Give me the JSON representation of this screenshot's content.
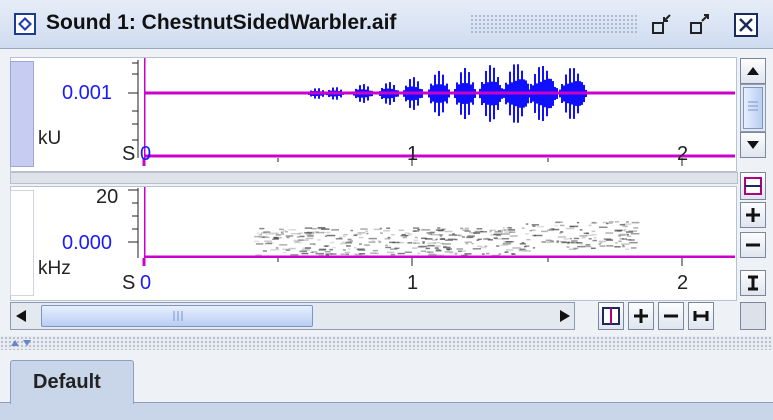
{
  "window": {
    "title": "Sound 1: ChestnutSidedWarbler.aif"
  },
  "waveform_track": {
    "value_label": "0.001",
    "unit_label": "kU",
    "time_unit": "S",
    "time_ticks": [
      "0",
      "1",
      "2"
    ]
  },
  "spectrogram_track": {
    "top_label": "20",
    "value_label": "0.000",
    "unit_label": "kHz",
    "time_unit": "S",
    "time_ticks": [
      "0",
      "1",
      "2"
    ]
  },
  "tabs": [
    {
      "label": "Default",
      "selected": true
    }
  ],
  "icons": {
    "title": "sound-window-icon",
    "minimize": "minimize-icon",
    "maximize": "maximize-icon",
    "close": "close-icon"
  },
  "colors": {
    "waveform": "#1010ff",
    "cursor_line": "#cc00cc",
    "axis_label": "#1a1aff"
  }
}
